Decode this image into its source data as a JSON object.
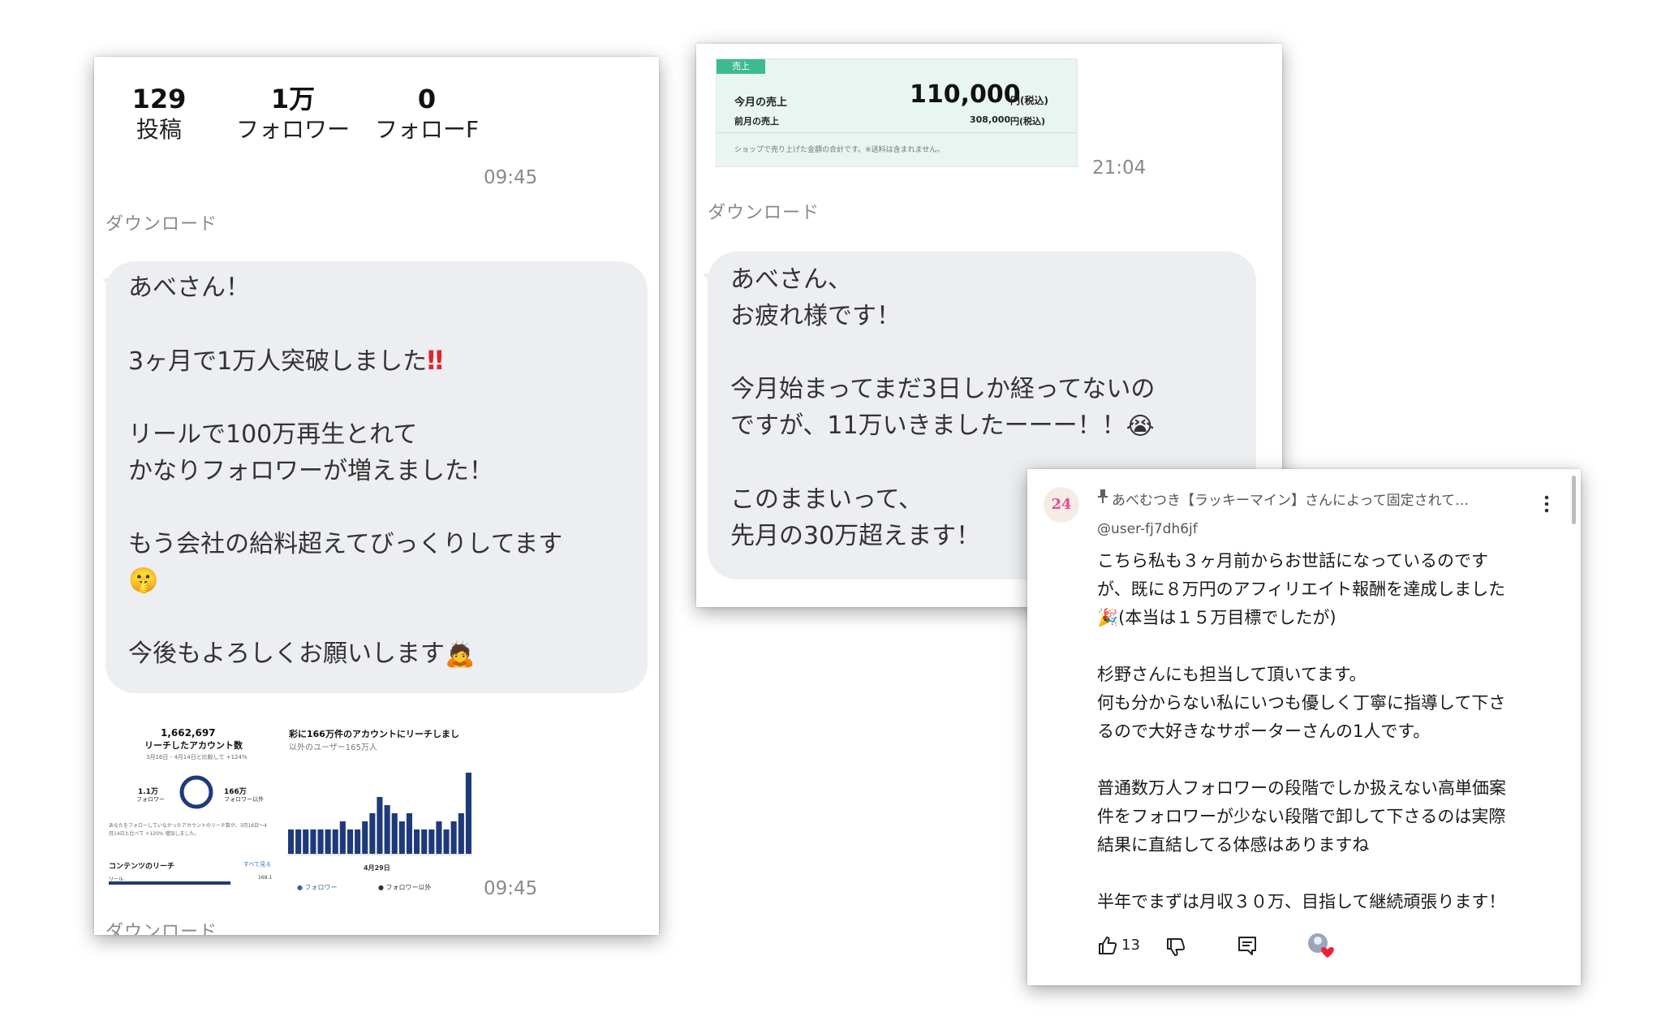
{
  "card1": {
    "stats": [
      {
        "value": "129",
        "label": "投稿"
      },
      {
        "value": "1万",
        "label": "フォロワー"
      },
      {
        "value": "0",
        "label": "フォローF"
      }
    ],
    "time_top": "09:45",
    "download_label": "ダウンロード",
    "message_lines": [
      "あべさん！",
      "",
      "3ヶ月で1万人突破しました",
      "",
      "リールで100万再生とれて",
      "かなりフォロワーが増えました！",
      "",
      "もう会社の給料超えてびっくりしてます",
      "",
      "",
      "今後もよろしくお願いします"
    ],
    "emoji": {
      "bang": "‼",
      "shush": "🤫",
      "bow": "🙇"
    },
    "insights": {
      "total_reach": "1,662,697",
      "reach_title": "リーチしたアカウント数",
      "reach_note": "3月16日 - 4月14日と比較して +124%",
      "followers_label": "1.1万",
      "followers_sub": "フォロワー",
      "nonfollowers_label": "166万",
      "nonfollowers_sub": "フォロワー以外",
      "headline": "彩に166万件のアカウントにリーチしまし",
      "headline_sub": "以外のユーザー165万人",
      "note_line1": "あなたをフォローしていなかったアカウントのリーチ数が、3月16日～4",
      "note_line2": "月14日と比べて +120% 増加しました。",
      "content_reach": "コンテンツのリーチ",
      "see_all": "すべて見る",
      "date_label": "4月29日",
      "legend_followers": "フォロワー",
      "legend_nonfollowers": "フォロワー以外",
      "reel_label": "リール",
      "reel_value": "169.1",
      "bars": [
        3,
        3,
        3,
        3,
        3,
        3,
        3,
        4,
        3,
        3,
        4,
        5,
        7,
        6,
        5,
        4,
        5,
        3,
        3,
        3,
        4,
        3,
        4,
        5,
        10
      ]
    },
    "time_bottom": "09:45",
    "download_label_bottom": "ダウンロード"
  },
  "card2": {
    "sales": {
      "tag": "売上",
      "this_month_label": "今月の売上",
      "this_month_value": "110,000",
      "this_month_unit": "円(税込)",
      "last_month_label": "前月の売上",
      "last_month_value": "308,000",
      "last_month_unit": "円(税込)",
      "note": "ショップで売り上げた金額の合計です。※送料は含まれません。"
    },
    "time": "21:04",
    "download_label": "ダウンロード",
    "message_lines": [
      "あべさん、",
      "お疲れ様です！",
      "",
      "今月始まってまだ3日しか経ってないの",
      "ですが、11万いきましたーーー！！",
      "",
      "このままいって、",
      "先月の30万超えます！"
    ],
    "emoji": {
      "cry": "😭"
    }
  },
  "card3": {
    "avatar_text": "24",
    "pinned": "あべむつき【ラッキーマイン】さんによって固定されて…",
    "username": "@user-fj7dh6jf",
    "comment_lines": [
      "こちら私も３ヶ月前からお世話になっているのです",
      "が、既に８万円のアフィリエイト報酬を達成しました",
      "(本当は１５万目標でしたが)",
      "",
      "杉野さんにも担当して頂いてます。",
      "何も分からない私にいつも優しく丁寧に指導して下さ",
      "るので大好きなサポーターさんの1人です。",
      "",
      "普通数万人フォロワーの段階でしか扱えない高単価案",
      "件をフォロワーが少ない段階で卸して下さるのは実際",
      "結果に直結してる体感はありますね",
      "",
      "半年でまずは月収３０万、目指して継続頑張ります！"
    ],
    "emoji": {
      "party": "🎉"
    },
    "like_count": "13",
    "icons": [
      "pin-icon",
      "more-icon",
      "like-icon",
      "dislike-icon",
      "reply-icon",
      "creator-heart-icon"
    ]
  }
}
